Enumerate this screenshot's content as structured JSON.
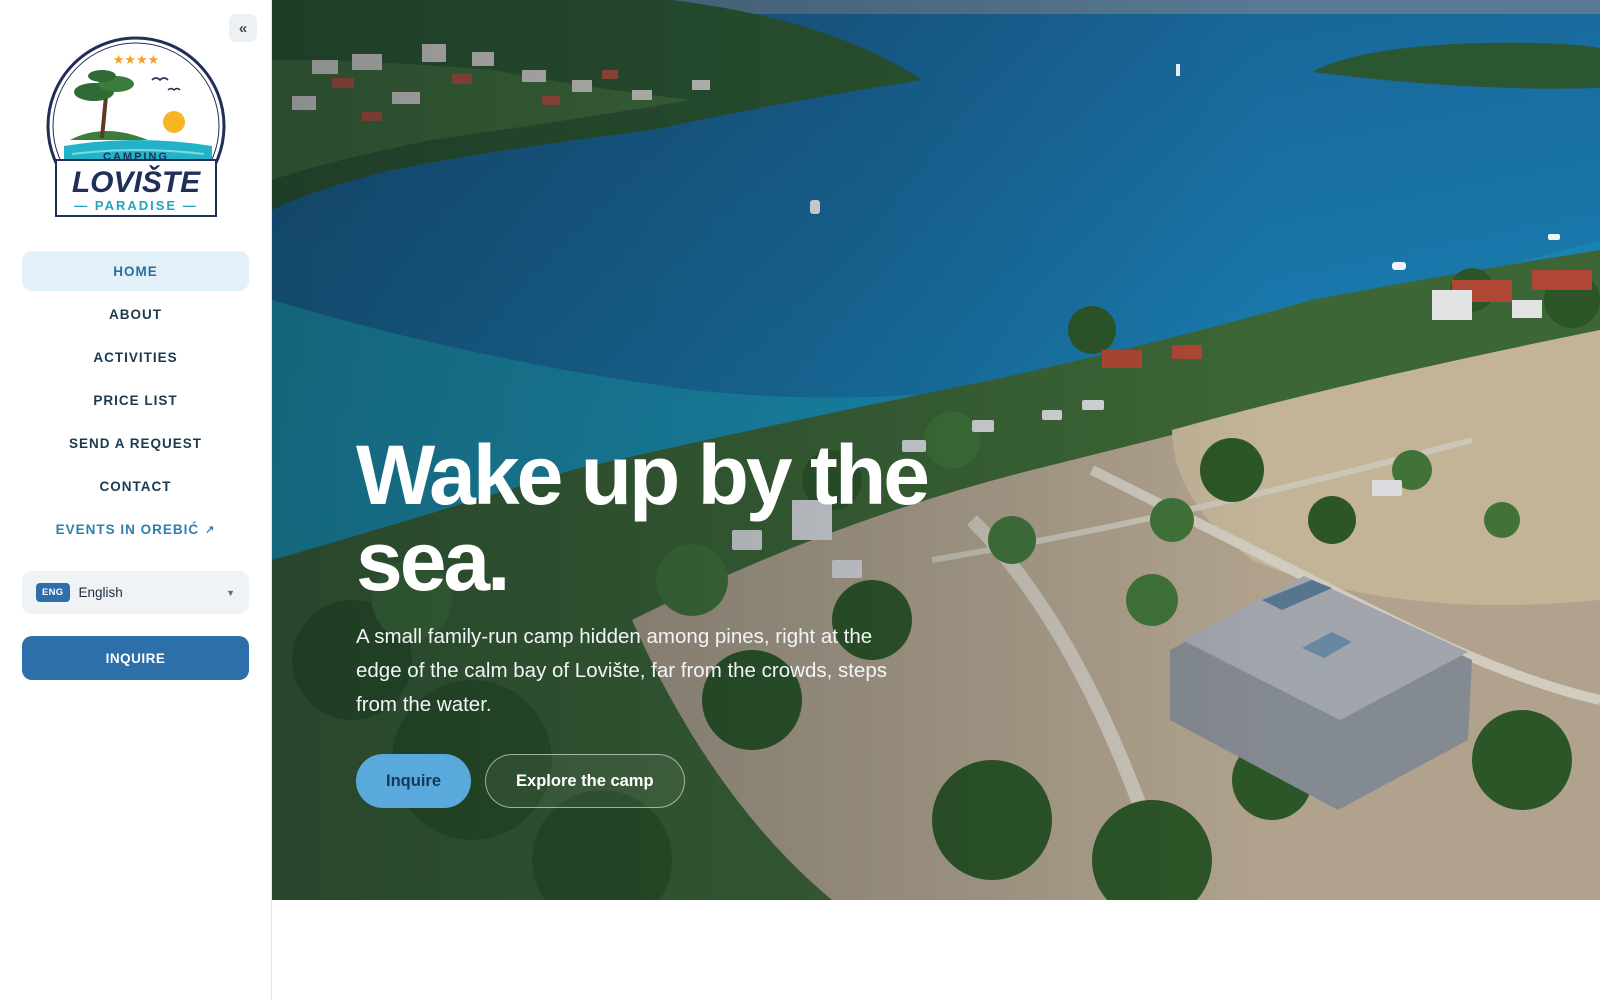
{
  "sidebar": {
    "collapse_icon": "double-chevron-left-icon",
    "logo": {
      "line1": "CAMPING",
      "line2": "LOVIŠTE",
      "line3": "— PARADISE —",
      "stars": "★★★★"
    },
    "nav": [
      {
        "label": "HOME",
        "active": true
      },
      {
        "label": "ABOUT"
      },
      {
        "label": "ACTIVITIES"
      },
      {
        "label": "PRICE LIST"
      },
      {
        "label": "SEND A REQUEST"
      },
      {
        "label": "CONTACT"
      },
      {
        "label": "EVENTS IN OREBIĆ",
        "external_icon": "↗"
      }
    ],
    "language": {
      "code": "ENG",
      "name": "English",
      "caret": "▼"
    },
    "inquire_label": "INQUIRE"
  },
  "hero": {
    "title": "Wake up by the sea.",
    "subtitle": "A small family-run camp hidden among pines, right at the edge of the calm bay of Lovište, far from the crowds, steps from the water.",
    "primary_button": "Inquire",
    "secondary_button": "Explore the camp"
  },
  "colors": {
    "accent": "#2d6fa8",
    "hero_primary_button": "#5aa9dc",
    "nav_active_bg": "#e2f0f8",
    "sea": "#1e6e9c"
  }
}
